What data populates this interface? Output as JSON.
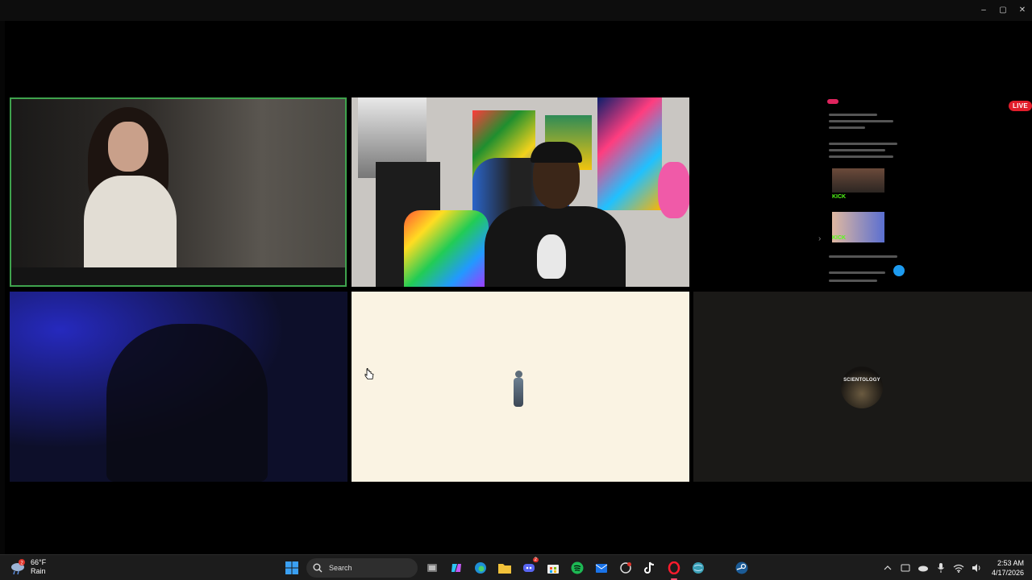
{
  "window": {
    "controls": {
      "minimize": "–",
      "maximize": "▢",
      "close": "✕"
    }
  },
  "tiles": {
    "t3": {
      "live_label": "LIVE",
      "kick_label_1": "KICK",
      "kick_label_2": "KICK"
    },
    "t6": {
      "avatar_text": "SCIENTOLOGY"
    }
  },
  "taskbar": {
    "weather": {
      "temp": "66°F",
      "condition": "Rain",
      "alert_count": "2"
    },
    "search_label": "Search",
    "discord_badge": "2",
    "clock": {
      "time": "2:53 AM",
      "date": "4/17/2026"
    },
    "apps": [
      "start-button",
      "search-box",
      "task-view",
      "copilot",
      "edge",
      "file-explorer",
      "discord",
      "microsoft-store",
      "spotify",
      "outlook",
      "chatgpt",
      "tiktok",
      "opera-gx",
      "browser-globe",
      "steam"
    ]
  },
  "colors": {
    "active_speaker_border": "#3fa34d",
    "live_red": "#e11d2b",
    "taskbar": "#1c1c1c"
  }
}
